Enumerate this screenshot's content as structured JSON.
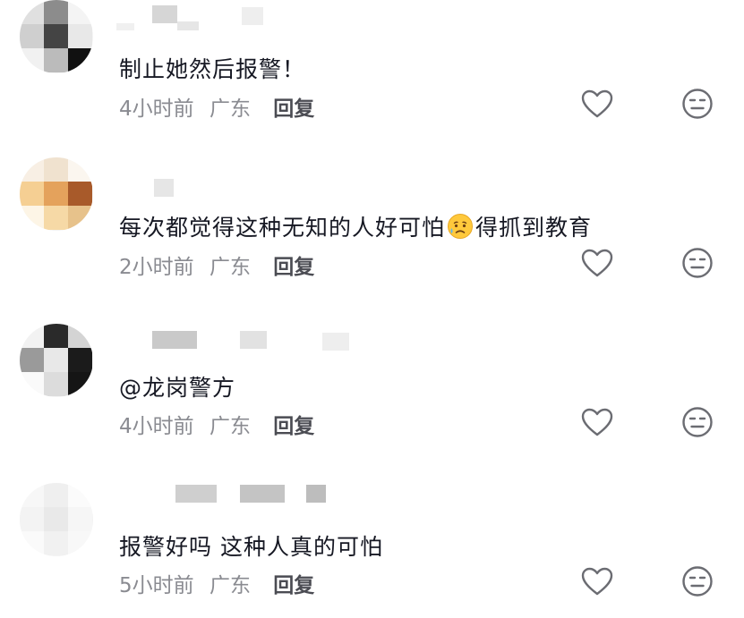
{
  "comments": [
    {
      "text": "制止她然后报警！",
      "time": "4小时前",
      "location": "广东",
      "reply_label": "回复",
      "like_icon": "heart-outline-icon",
      "dislike_icon": "neutral-face-icon"
    },
    {
      "text_before_emoji": "每次都觉得这种无知的人好可怕",
      "emoji": "sad-sweat-face-icon",
      "text_after_emoji": "得抓到教育",
      "time": "2小时前",
      "location": "广东",
      "reply_label": "回复",
      "like_icon": "heart-outline-icon",
      "dislike_icon": "neutral-face-icon"
    },
    {
      "text": "@龙岗警方",
      "time": "4小时前",
      "location": "广东",
      "reply_label": "回复",
      "like_icon": "heart-outline-icon",
      "dislike_icon": "neutral-face-icon"
    },
    {
      "text": "报警好吗 这种人真的可怕",
      "time": "5小时前",
      "location": "广东",
      "reply_label": "回复",
      "like_icon": "heart-outline-icon",
      "dislike_icon": "neutral-face-icon"
    }
  ],
  "colors": {
    "text": "#161823",
    "meta": "#8a8b91",
    "reply": "#4b4c53",
    "icon": "#6b6c72"
  }
}
